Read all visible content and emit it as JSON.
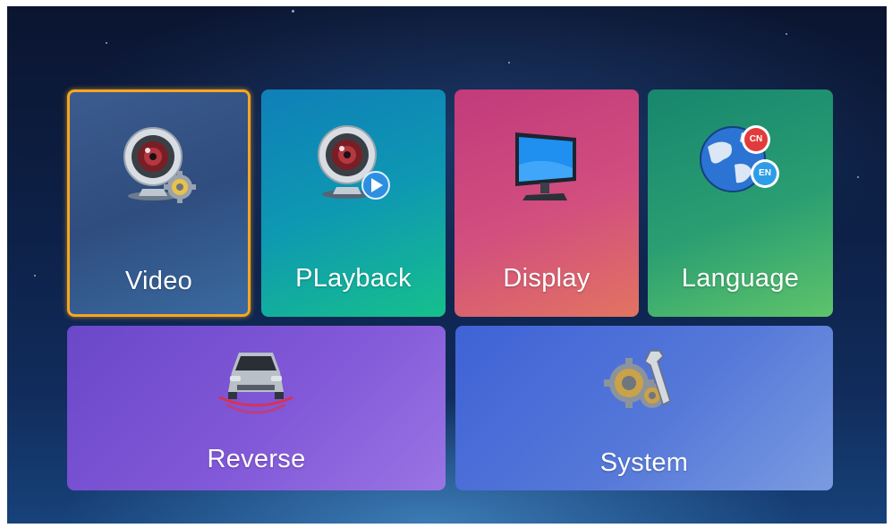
{
  "menu": {
    "video": {
      "label": "Video",
      "icon": "camera-settings-icon",
      "selected": true
    },
    "playback": {
      "label": "PLayback",
      "icon": "camera-play-icon"
    },
    "display": {
      "label": "Display",
      "icon": "monitor-icon"
    },
    "language": {
      "label": "Language",
      "icon": "globe-language-icon",
      "badge_cn": "CN",
      "badge_en": "EN"
    },
    "reverse": {
      "label": "Reverse",
      "icon": "car-rear-sensor-icon"
    },
    "system": {
      "label": "System",
      "icon": "gear-wrench-icon"
    }
  },
  "colors": {
    "selection_border": "#f5a623",
    "video_tile": "#2f4d7e",
    "playback_tile": "#0e98b2",
    "display_tile": "#d24f7e",
    "language_tile": "#2a9e72",
    "reverse_tile": "#8158d8",
    "system_tile": "#5578d9"
  }
}
